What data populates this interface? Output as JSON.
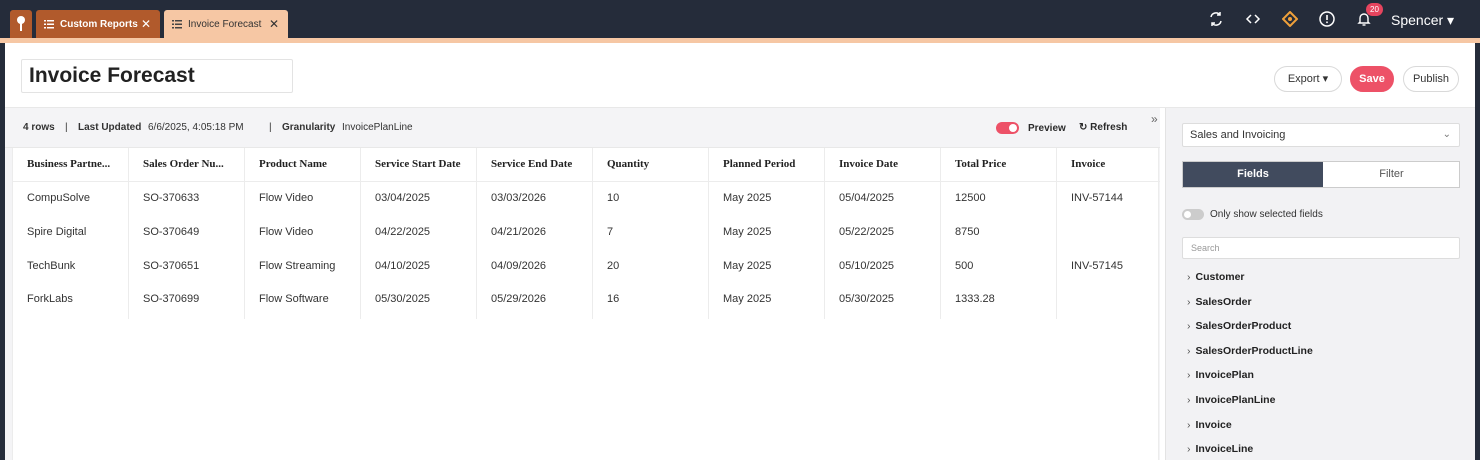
{
  "tabs": [
    {
      "label": "Custom Reports",
      "close": "✕"
    },
    {
      "label": "Invoice Forecast",
      "close": "✕"
    }
  ],
  "user": {
    "name": "Spencer ▾",
    "notifications": "20"
  },
  "page": {
    "title": "Invoice Forecast"
  },
  "actions": {
    "export": "Export ▾",
    "save": "Save",
    "publish": "Publish"
  },
  "info": {
    "rows": "4 rows",
    "sep": "|",
    "updated_label": "Last Updated",
    "updated_value": "6/6/2025, 4:05:18 PM",
    "granularity_label": "Granularity",
    "granularity_value": "InvoicePlanLine",
    "preview": "Preview",
    "refresh": "Refresh",
    "collapse": "»"
  },
  "table": {
    "columns": [
      "Business Partne...",
      "Sales Order Nu...",
      "Product Name",
      "Service Start Date",
      "Service End Date",
      "Quantity",
      "Planned Period",
      "Invoice Date",
      "Total Price",
      "Invoice"
    ],
    "rows": [
      [
        "CompuSolve",
        "SO-370633",
        "Flow Video",
        "03/04/2025",
        "03/03/2026",
        "10",
        "May 2025",
        "05/04/2025",
        "12500",
        "INV-57144"
      ],
      [
        "Spire Digital",
        "SO-370649",
        "Flow Video",
        "04/22/2025",
        "04/21/2026",
        "7",
        "May 2025",
        "05/22/2025",
        "8750",
        ""
      ],
      [
        "TechBunk",
        "SO-370651",
        "Flow Streaming",
        "04/10/2025",
        "04/09/2026",
        "20",
        "May 2025",
        "05/10/2025",
        "500",
        "INV-57145"
      ],
      [
        "ForkLabs",
        "SO-370699",
        "Flow Software",
        "05/30/2025",
        "05/29/2026",
        "16",
        "May 2025",
        "05/30/2025",
        "1333.28",
        ""
      ]
    ]
  },
  "panel": {
    "dataset": "Sales and Invoicing",
    "tabs": {
      "fields": "Fields",
      "filter": "Filter"
    },
    "only_selected": "Only show selected fields",
    "search_placeholder": "Search",
    "entities": [
      "Customer",
      "SalesOrder",
      "SalesOrderProduct",
      "SalesOrderProductLine",
      "InvoicePlan",
      "InvoicePlanLine",
      "Invoice",
      "InvoiceLine"
    ]
  },
  "colors": {
    "accent": "#ed5167",
    "tab_active": "#b15a2c",
    "tab_light": "#f6c7a4",
    "topbar": "#252c3a"
  }
}
